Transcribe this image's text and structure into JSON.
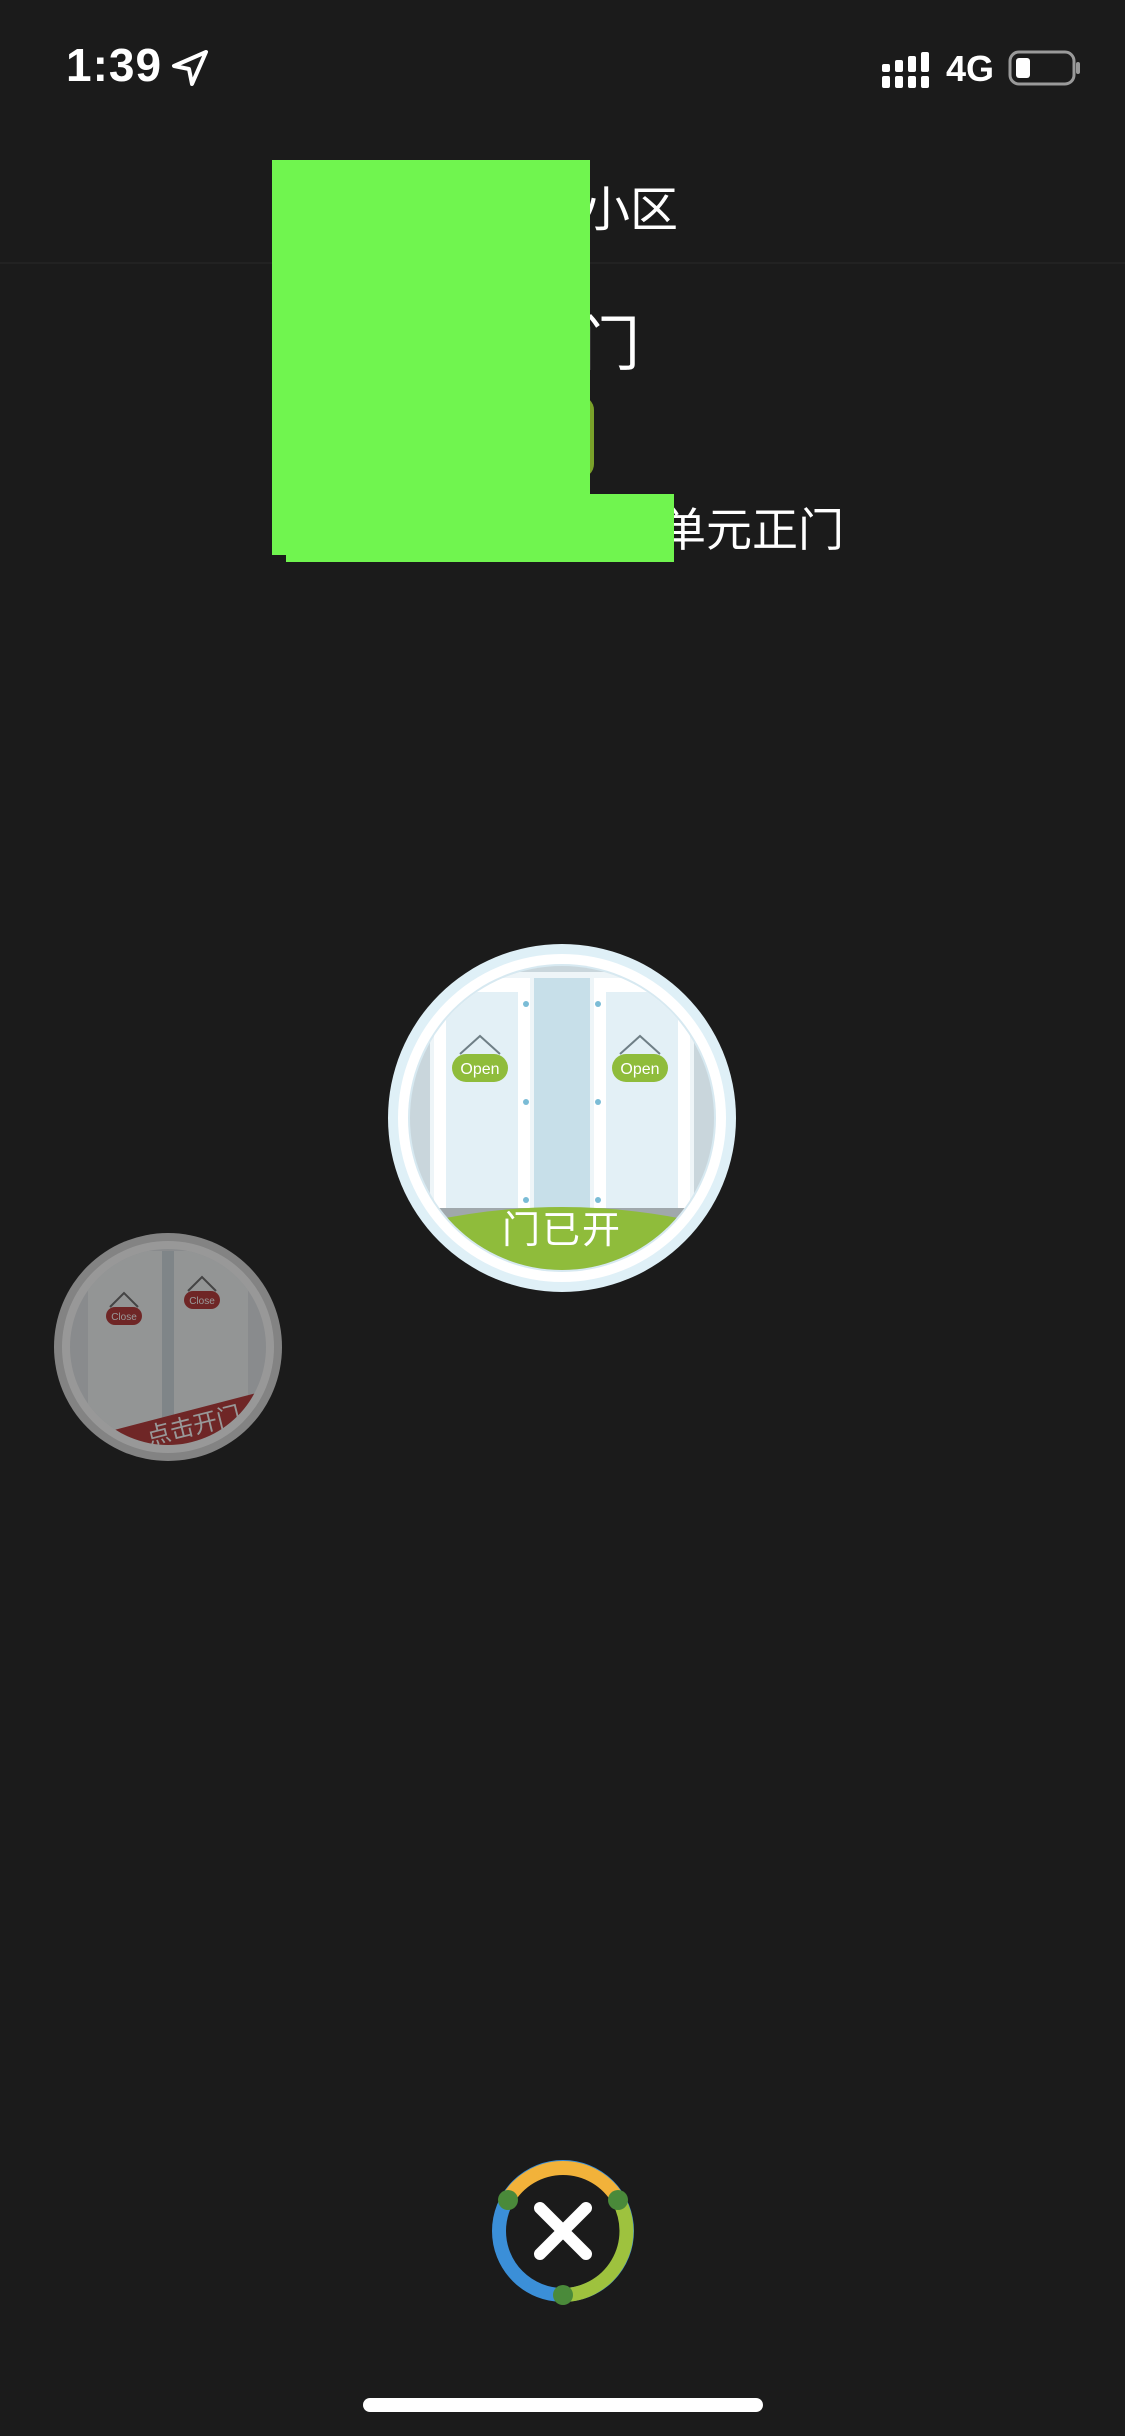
{
  "status_bar": {
    "time": "1:39",
    "network": "4G",
    "icons": [
      "location-arrow-icon",
      "signal-icon",
      "battery-icon"
    ]
  },
  "header": {
    "community_name": "小区",
    "door_title": "门",
    "unit_door": "单元正门"
  },
  "doors": {
    "open": {
      "status_label": "门已开",
      "sign_left": "Open",
      "sign_right": "Open"
    },
    "closed": {
      "action_label": "点击开门",
      "sign_left": "Close",
      "sign_right": "Close"
    }
  },
  "close_button": {
    "icon": "close-icon"
  },
  "colors": {
    "background": "#1b1b1b",
    "redaction": "#70f54f",
    "open_green": "#8fbc3b",
    "closed_red": "#b4302f",
    "ring_yellow": "#f2b23a",
    "ring_green": "#9ec23e",
    "ring_blue": "#3b8fd8"
  }
}
